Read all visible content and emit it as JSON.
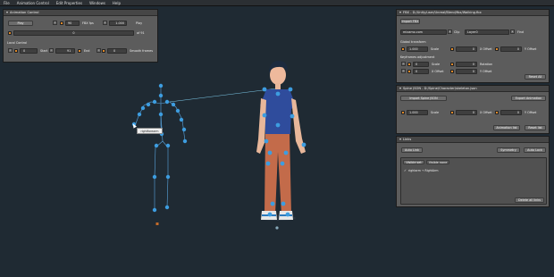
{
  "menu": [
    "File",
    "Animation Control",
    "Edit Properties",
    "Windows",
    "Help"
  ],
  "animation_panel": {
    "title": "Animation Control",
    "play_label": "Play",
    "frame_value": "90",
    "fps_label": "FBX fps",
    "speed_value": "1.000",
    "speed_label": "Play speed",
    "timeline_value": "0",
    "timeline_suffix": "of 91",
    "local_control_label": "Local Control",
    "start_value": "0",
    "start_label": "Start",
    "end_value": "91",
    "end_label": "End",
    "smooth_value": "0",
    "smooth_label": "Smooth frames"
  },
  "fbx_panel": {
    "title": "FBX - D:/Unity/user/Unreal/Blend/fbx/Walking.fbx",
    "import_label": "Import FBX",
    "transform_field": "mixamo.com",
    "clip_label": "Clip",
    "layer_field": "Layer0",
    "find_label": "Find",
    "global_label": "Global transform",
    "scale_value": "1.000",
    "scale_label": "Scale",
    "xoffset_value": "0",
    "xoffset_label": "X Offset",
    "yoffset_label": "Y Offset",
    "keyframes_label": "Keyframes adjustment",
    "ks_value": "0",
    "ks_label": "Scale",
    "rot_value": "0",
    "rot_label": "Rotation",
    "kx_value": "0",
    "kx_label": "X Offset",
    "ky_value": "0",
    "ky_label": "Y Offset",
    "reset_label": "Reset All"
  },
  "spine_panel": {
    "title": "Spine JSON - D:/Spine/Character/skeleton.json",
    "import_label": "Import Spine JSON",
    "export_label": "Export Animation",
    "scale_value": "1.000",
    "scale_label": "Scale",
    "x_value": "0",
    "x_label": "X Offset",
    "y_value": "0",
    "y_label": "Y Offset",
    "animation_list_label": "Animation list",
    "reset_label": "Reset list"
  },
  "links_panel": {
    "title": "Links",
    "auto_link_label": "Auto Link",
    "symmetry_label": "Symmetry",
    "auto_lock_label": "Auto Lock",
    "visible_tab": "Visible set",
    "visible_none_tab": "Visible none",
    "link_entry": "rightarm → RightArm",
    "delete_label": "Delete all links"
  },
  "scene": {
    "tooltip": "rightforearm"
  },
  "colors": {
    "background": "#1f2a33",
    "joint": "#3d9de0",
    "bone": "#5aa6e0",
    "link_line": "#7cc8e8",
    "panel": "#5c5c5c",
    "accent": "#e08a2a"
  }
}
